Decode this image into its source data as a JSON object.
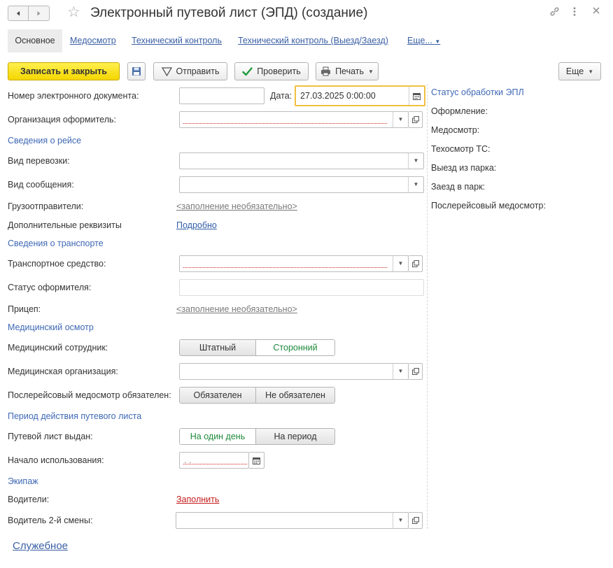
{
  "window": {
    "title": "Электронный путевой лист (ЭПД) (создание)"
  },
  "tabs": [
    {
      "label": "Основное"
    },
    {
      "label": "Медосмотр"
    },
    {
      "label": "Технический контроль"
    },
    {
      "label": "Технический контроль (Выезд/Заезд)"
    },
    {
      "label": "Еще..."
    }
  ],
  "toolbar": {
    "save_close": "Записать и закрыть",
    "send": "Отправить",
    "check": "Проверить",
    "print": "Печать",
    "more": "Еще"
  },
  "form": {
    "doc_number_label": "Номер электронного документа:",
    "doc_number_value": "",
    "date_label": "Дата:",
    "date_value": "27.03.2025  0:00:00",
    "org_label": "Организация оформитель:",
    "trip_section": "Сведения о рейсе",
    "transport_kind_label": "Вид перевозки:",
    "message_kind_label": "Вид сообщения:",
    "shippers_label": "Грузоотправители:",
    "optional_fill": "<заполнение необязательно>",
    "extra_label": "Дополнительные реквизиты",
    "extra_link": "Подробно",
    "vehicle_section": "Сведения о транспорте",
    "vehicle_label": "Транспортное средство:",
    "issuer_status_label": "Статус оформителя:",
    "trailer_label": "Прицеп:",
    "med_section": "Медицинский осмотр",
    "med_staff_label": "Медицинский сотрудник:",
    "med_staff_options": [
      "Штатный",
      "Сторонний"
    ],
    "med_org_label": "Медицинская организация:",
    "post_med_label": "Послерейсовый медосмотр обязателен:",
    "post_med_options": [
      "Обязателен",
      "Не обязателен"
    ],
    "period_section": "Период действия путевого листа",
    "issued_label": "Путевой лист выдан:",
    "issued_options": [
      "На один день",
      "На период"
    ],
    "start_label": "Начало использования:",
    "start_value": " .  .",
    "crew_section": "Экипаж",
    "drivers_label": "Водители:",
    "drivers_link": "Заполнить",
    "driver2_label": "Водитель 2-й смены:"
  },
  "status_panel": {
    "title": "Статус обработки ЭПЛ",
    "items": [
      "Оформление:",
      "Медосмотр:",
      "Техосмотр ТС:",
      "Выезд из парка:",
      "Заезд в парк:",
      "Послерейсовый медосмотр:"
    ]
  },
  "footer": {
    "service_link": "Служебное"
  },
  "colors": {
    "accent_yellow": "#f4d600",
    "link_blue": "#2f5ca8",
    "section_blue": "#3e68b4",
    "required_red": "#d11a1a",
    "selected_green": "#1e8a3b",
    "focus_orange": "#f0c040"
  },
  "icons": {
    "back": "arrow-left-icon",
    "forward": "arrow-right-icon",
    "favorite": "star-icon",
    "link": "link-icon",
    "menu": "more-vertical-icon",
    "close": "close-icon",
    "save": "floppy-disk-icon",
    "send": "send-icon",
    "check": "checkmark-icon",
    "print": "printer-icon",
    "calendar": "calendar-icon",
    "open": "open-window-icon"
  }
}
